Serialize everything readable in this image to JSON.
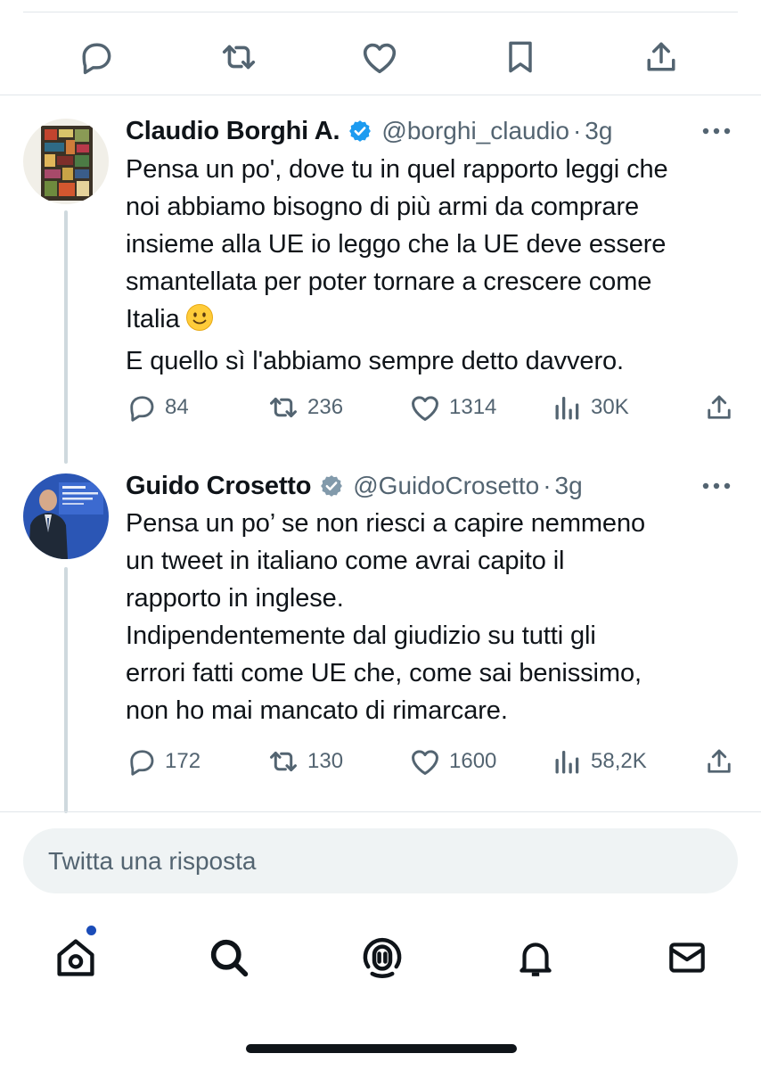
{
  "tweets": [
    {
      "name": "Claudio Borghi A.",
      "handle": "@borghi_claudio",
      "dot": "·",
      "time": "3g",
      "verified_color": "#1d9bf0",
      "lines": [
        "Pensa un po', dove tu in quel rapporto leggi che",
        "noi abbiamo bisogno di più armi da comprare",
        "insieme alla UE io leggo che la UE deve essere",
        "smantellata per poter tornare a crescere come",
        "Italia",
        "E quello sì l'abbiamo sempre detto davvero."
      ],
      "emoji": "slightly-smiling-face",
      "stats": {
        "replies": "84",
        "retweets": "236",
        "likes": "1314",
        "views": "30K"
      }
    },
    {
      "name": "Guido Crosetto",
      "handle": "@GuidoCrosetto",
      "dot": "·",
      "time": "3g",
      "verified_color": "#829aab",
      "lines": [
        "Pensa un po’ se non riesci a capire nemmeno",
        "un tweet in italiano come avrai capito il",
        "rapporto in inglese.",
        "Indipendentemente dal giudizio su tutti gli",
        "errori fatti come UE che, come sai benissimo,",
        "non ho mai mancato di rimarcare."
      ],
      "stats": {
        "replies": "172",
        "retweets": "130",
        "likes": "1600",
        "views": "58,2K"
      }
    }
  ],
  "reply": {
    "placeholder": "Twitta una risposta"
  },
  "icons": {
    "top_actions": [
      "reply-icon",
      "retweet-icon",
      "like-icon",
      "bookmark-icon",
      "share-icon"
    ],
    "nav": [
      "home-icon",
      "search-icon",
      "spaces-icon",
      "notifications-icon",
      "messages-icon"
    ]
  },
  "colors": {
    "text": "#0f1419",
    "secondary": "#536471",
    "divider": "#e1e6ea",
    "reply_bg": "#eff3f4",
    "notification_dot": "#1a4cb8"
  }
}
